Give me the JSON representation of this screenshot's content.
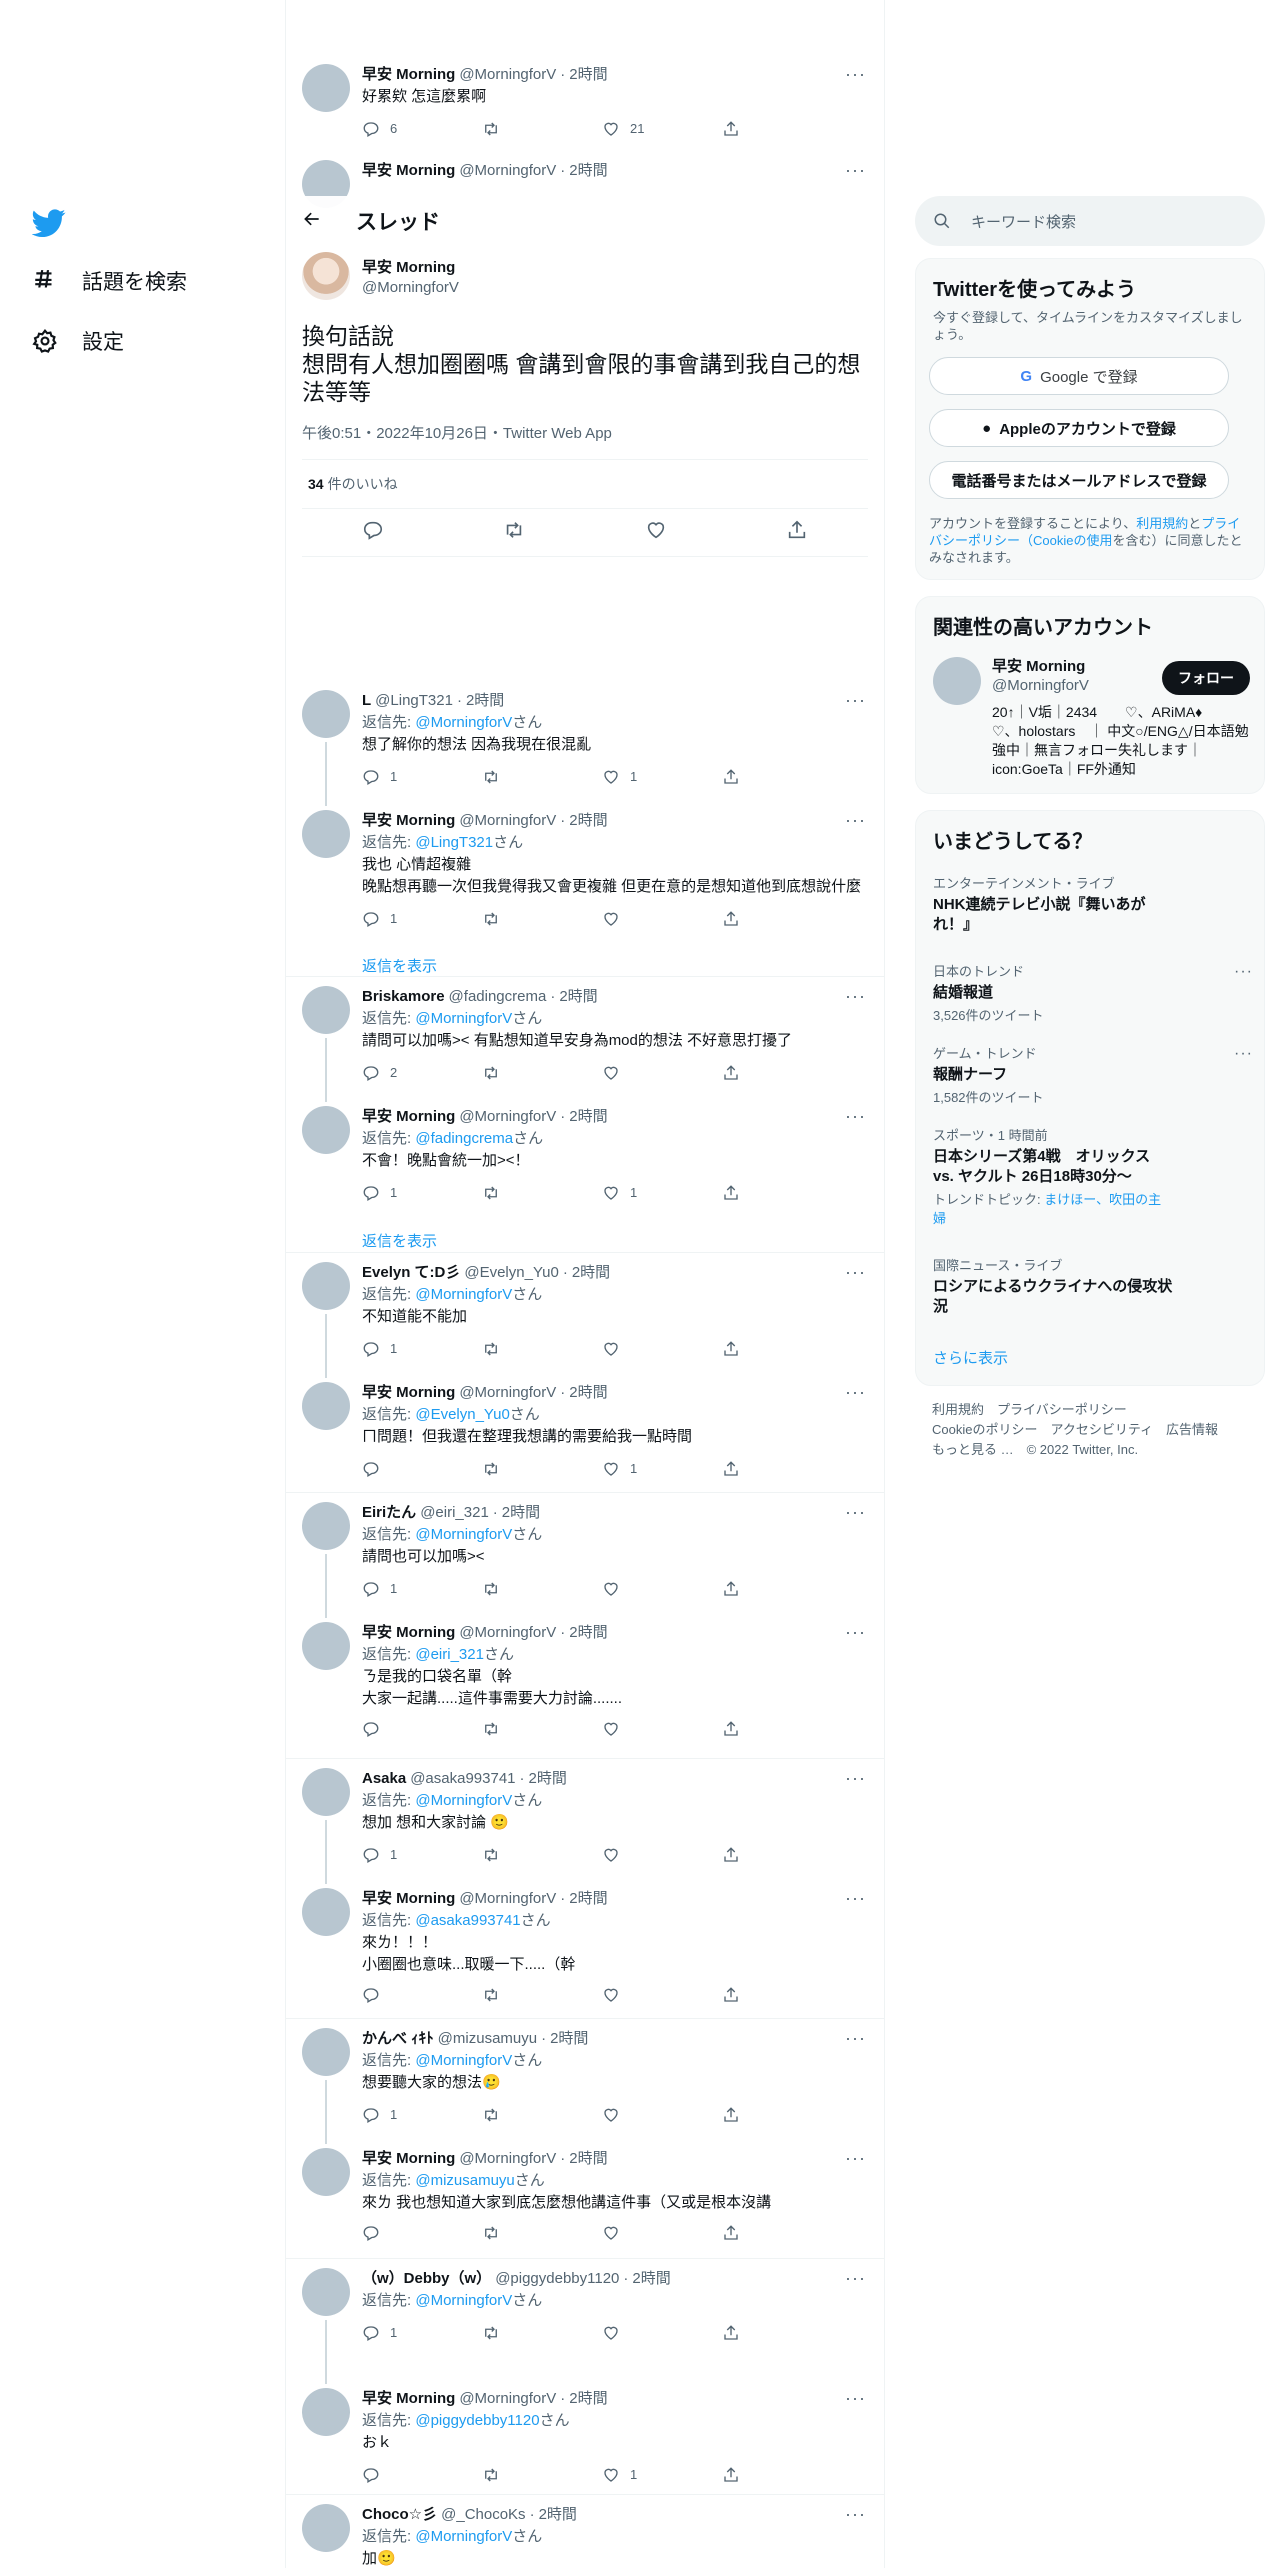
{
  "nav": {
    "explore_label": "話題を検索",
    "settings_label": "設定"
  },
  "thread_header": {
    "title": "スレッド"
  },
  "above_tweets": [
    {
      "name": "早安 Morning",
      "handle": "@MorningforV",
      "time": "2時間",
      "text": "好累欸 怎這麼累啊",
      "replies": "6",
      "retweets": "",
      "likes": "21"
    },
    {
      "name": "早安 Morning",
      "handle": "@MorningforV",
      "time": "2時間",
      "text": ""
    }
  ],
  "main_tweet": {
    "name": "早安 Morning",
    "handle": "@MorningforV",
    "text": "換句話說\n想問有人想加圈圈嗎 會講到會限的事會講到我自己的想法等等",
    "meta": "午後0:51・2022年10月26日・Twitter Web App",
    "likes_count": "34",
    "likes_label": "件のいいね"
  },
  "reply_prefix": "返信先: ",
  "reply_suffix": "さん",
  "show_replies_label": "返信を表示",
  "replies": [
    {
      "name": "L",
      "handle": "@LingT321",
      "time": "2時間",
      "to": "@MorningforV",
      "text": "想了解你的想法 因為我現在很混亂",
      "r": "1",
      "rt": "",
      "l": "1"
    },
    {
      "name": "早安 Morning",
      "handle": "@MorningforV",
      "time": "2時間",
      "to": "@LingT321",
      "text": "我也 心情超複雜\n晚點想再聽一次但我覺得我又會更複雜 但更在意的是想知道他到底想說什麼",
      "r": "1",
      "rt": "",
      "l": ""
    },
    {
      "name": "Briskamore",
      "handle": "@fadingcrema",
      "time": "2時間",
      "to": "@MorningforV",
      "text": "請問可以加嗎>< 有點想知道早安身為mod的想法 不好意思打擾了",
      "r": "2",
      "rt": "",
      "l": ""
    },
    {
      "name": "早安 Morning",
      "handle": "@MorningforV",
      "time": "2時間",
      "to": "@fadingcrema",
      "text": "不會！晚點會統一加><！",
      "r": "1",
      "rt": "",
      "l": "1"
    },
    {
      "name": "Evelyn て:D彡",
      "handle": "@Evelyn_Yu0",
      "time": "2時間",
      "to": "@MorningforV",
      "text": "不知道能不能加",
      "r": "1",
      "rt": "",
      "l": ""
    },
    {
      "name": "早安 Morning",
      "handle": "@MorningforV",
      "time": "2時間",
      "to": "@Evelyn_Yu0",
      "text": "ㄇ問題！但我還在整理我想講的需要給我一點時間",
      "r": "",
      "rt": "",
      "l": "1"
    },
    {
      "name": "Eiriたん",
      "handle": "@eiri_321",
      "time": "2時間",
      "to": "@MorningforV",
      "text": "請問也可以加嗎><",
      "r": "1",
      "rt": "",
      "l": ""
    },
    {
      "name": "早安 Morning",
      "handle": "@MorningforV",
      "time": "2時間",
      "to": "@eiri_321",
      "text": "ㄋ是我的口袋名單（幹\n大家一起講.....這件事需要大力討論.......",
      "r": "",
      "rt": "",
      "l": ""
    },
    {
      "name": "Asaka",
      "handle": "@asaka993741",
      "time": "2時間",
      "to": "@MorningforV",
      "text": "想加 想和大家討論 🙂",
      "r": "1",
      "rt": "",
      "l": ""
    },
    {
      "name": "早安 Morning",
      "handle": "@MorningforV",
      "time": "2時間",
      "to": "@asaka993741",
      "text": "來ㄌ！！！\n小圈圈也意味...取暖一下.....（幹",
      "r": "",
      "rt": "",
      "l": ""
    },
    {
      "name": "かんべ ｨｷﾄ",
      "handle": "@mizusamuyu",
      "time": "2時間",
      "to": "@MorningforV",
      "text": "想要聽大家的想法🥲",
      "r": "1",
      "rt": "",
      "l": ""
    },
    {
      "name": "早安 Morning",
      "handle": "@MorningforV",
      "time": "2時間",
      "to": "@mizusamuyu",
      "text": "來ㄌ 我也想知道大家到底怎麼想他講這件事（又或是根本沒講",
      "r": "",
      "rt": "",
      "l": ""
    },
    {
      "name": "（w）Debby（w）",
      "handle": "@piggydebby1120",
      "time": "2時間",
      "to": "@MorningforV",
      "text": "",
      "r": "1",
      "rt": "",
      "l": ""
    },
    {
      "name": "早安 Morning",
      "handle": "@MorningforV",
      "time": "2時間",
      "to": "@piggydebby1120",
      "text": "おｋ",
      "r": "",
      "rt": "",
      "l": "1"
    },
    {
      "name": "Choco☆彡",
      "handle": "@_ChocoKs",
      "time": "2時間",
      "to": "@MorningforV",
      "text": "加🙂",
      "r": "",
      "rt": "",
      "l": ""
    }
  ],
  "right": {
    "search_placeholder": "キーワード検索",
    "signup": {
      "title": "Twitterを使ってみよう",
      "subtitle": "今すぐ登録して、タイムラインをカスタマイズしましょう。",
      "google": "Google で登録",
      "apple": "Appleのアカウントで登録",
      "phone": "電話番号またはメールアドレスで登録",
      "terms_1": "アカウントを登録することにより、",
      "terms_link_1": "利用規約",
      "terms_2": "と",
      "terms_link_2": "プライバシーポリシー（Cookieの使用",
      "terms_3": "を含む）に同意したとみなされます。"
    },
    "related": {
      "title": "関連性の高いアカウント",
      "name": "早安 Morning",
      "handle": "@MorningforV",
      "follow": "フォロー",
      "bio": "20↑｜V垢｜2434　　♡、ARiMA♦　　♡、holostars　｜ 中文○/ENG△/日本語勉強中｜無言フォロー失礼します｜ icon:GoeTa｜FF外通知"
    },
    "trends": {
      "title": "いまどうしてる？",
      "items": [
        {
          "cat": "エンターテインメント・ライブ",
          "title": "NHK連続テレビ小説『舞いあがれ！』",
          "count": "",
          "topics": ""
        },
        {
          "cat": "日本のトレンド",
          "title": "結婚報道",
          "count": "3,526件のツイート",
          "topics": ""
        },
        {
          "cat": "ゲーム・トレンド",
          "title": "報酬ナーフ",
          "count": "1,582件のツイート",
          "topics": ""
        },
        {
          "cat": "スポーツ・1 時間前",
          "title": "日本シリーズ第4戦　オリックス vs. ヤクルト 26日18時30分〜",
          "count": "",
          "topics_label": "トレンドトピック: ",
          "topics": "まけほー、吹田の主婦"
        },
        {
          "cat": "国際ニュース・ライブ",
          "title": "ロシアによるウクライナへの侵攻状況",
          "count": "",
          "topics": ""
        }
      ],
      "more": "さらに表示"
    },
    "footer": {
      "line1": "利用規約　プライバシーポリシー",
      "line2": "Cookieのポリシー　アクセシビリティ　広告情報",
      "line3": "もっと見る …　© 2022 Twitter, Inc."
    }
  },
  "colors": {
    "accent": "#1d9bf0",
    "muted": "#536471",
    "follow_bg": "#0f1419"
  }
}
